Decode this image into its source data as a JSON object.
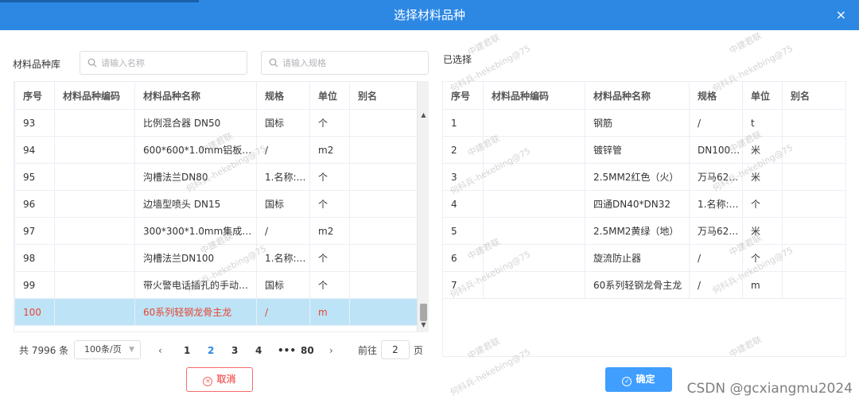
{
  "dialog": {
    "title": "选择材料品种",
    "close_glyph": "×"
  },
  "library": {
    "label": "材料品种库",
    "search_name_placeholder": "请输入名称",
    "search_spec_placeholder": "请输入规格"
  },
  "selected": {
    "label": "已选择"
  },
  "left_table": {
    "headers": [
      "序号",
      "材料品种编码",
      "材料品种名称",
      "规格",
      "单位",
      "别名"
    ],
    "rows": [
      [
        "93",
        "",
        "比例混合器 DN50",
        "国标",
        "个",
        ""
      ],
      [
        "94",
        "",
        "600*600*1.0mm铝板…",
        "/",
        "m2",
        ""
      ],
      [
        "95",
        "",
        "沟槽法兰DN80",
        "1.名称:…",
        "个",
        ""
      ],
      [
        "96",
        "",
        "边墙型喷头 DN15",
        "国标",
        "个",
        ""
      ],
      [
        "97",
        "",
        "300*300*1.0mm集成…",
        "/",
        "m2",
        ""
      ],
      [
        "98",
        "",
        "沟槽法兰DN100",
        "1.名称:…",
        "个",
        ""
      ],
      [
        "99",
        "",
        "带火警电话插孔的手动…",
        "国标",
        "个",
        ""
      ],
      [
        "100",
        "",
        "60系列轻钢龙骨主龙",
        "/",
        "m",
        ""
      ]
    ]
  },
  "right_table": {
    "headers": [
      "序号",
      "材料品种编码",
      "材料品种名称",
      "规格",
      "单位",
      "别名"
    ],
    "rows": [
      [
        "1",
        "",
        "钢筋",
        "/",
        "t",
        ""
      ],
      [
        "2",
        "",
        "镀锌管",
        "DN100…",
        "米",
        ""
      ],
      [
        "3",
        "",
        "2.5MM2红色（火）",
        "万马62…",
        "米",
        ""
      ],
      [
        "4",
        "",
        "四通DN40*DN32",
        "1.名称:…",
        "个",
        ""
      ],
      [
        "5",
        "",
        "2.5MM2黄绿（地）",
        "万马62…",
        "米",
        ""
      ],
      [
        "6",
        "",
        "旋流防止器",
        "/",
        "个",
        ""
      ],
      [
        "7",
        "",
        "60系列轻钢龙骨主龙",
        "/",
        "m",
        ""
      ]
    ]
  },
  "pagination": {
    "total": "共 7996 条",
    "page_size": "100条/页",
    "prev": "‹",
    "pages": [
      "1",
      "2",
      "3",
      "4",
      "•••",
      "80"
    ],
    "active_page": "2",
    "next": "›",
    "goto_label": "前往",
    "goto_value": "2",
    "goto_suffix": "页"
  },
  "buttons": {
    "cancel": "取消",
    "confirm": "确定"
  },
  "watermark": {
    "company": "中建君联",
    "user": "何科兵-hekebing@75"
  },
  "footer": {
    "csdn": "CSDN @gcxiangmu2024"
  },
  "colors": {
    "header_blue": "#2d88e4",
    "highlight_row": "#bde3f7",
    "highlight_text": "#e8452e",
    "cancel_red": "#f56c6c",
    "confirm_blue": "#409eff"
  }
}
